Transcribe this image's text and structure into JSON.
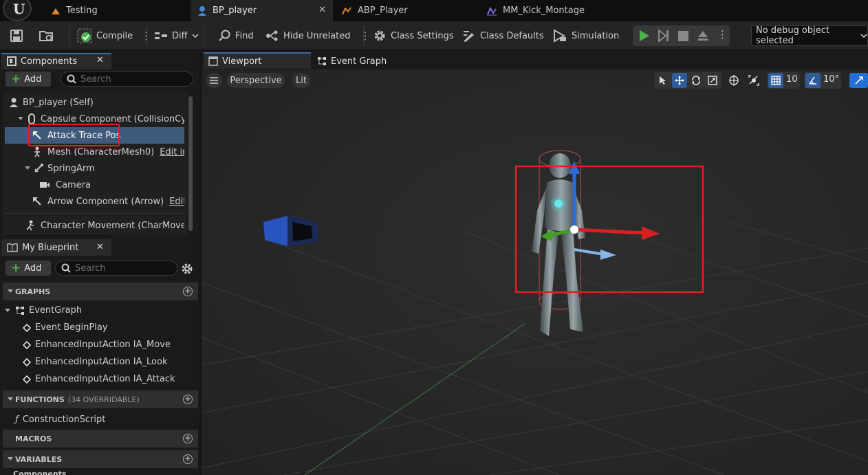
{
  "tabs": [
    {
      "label": "Testing",
      "icon": "level-icon"
    },
    {
      "label": "BP_player",
      "icon": "blueprint-pawn-icon",
      "active": true
    },
    {
      "label": "ABP_Player",
      "icon": "anim-blueprint-icon"
    },
    {
      "label": "MM_Kick_Montage",
      "icon": "montage-icon"
    }
  ],
  "toolbar": {
    "compile": "Compile",
    "diff": "Diff",
    "find": "Find",
    "hide_unrelated": "Hide Unrelated",
    "class_settings": "Class Settings",
    "class_defaults": "Class Defaults",
    "simulation": "Simulation",
    "debug_object": "No debug object selected"
  },
  "components_panel": {
    "title": "Components",
    "add_label": "Add",
    "search_placeholder": "Search",
    "items": [
      {
        "label": "BP_player (Self)",
        "indent": 0
      },
      {
        "label": "Capsule Component (CollisionCylinder)",
        "indent": 1
      },
      {
        "label": "Attack Trace Pos",
        "indent": 2,
        "selected": true
      },
      {
        "label": "Mesh (CharacterMesh0)",
        "indent": 2,
        "link": "Edit in C++"
      },
      {
        "label": "SpringArm",
        "indent": 2
      },
      {
        "label": "Camera",
        "indent": 3
      },
      {
        "label": "Arrow Component (Arrow)",
        "indent": 2,
        "link": "Edit in C++"
      },
      {
        "label": "Character Movement (CharMoveComp)",
        "indent": 1
      }
    ]
  },
  "my_blueprint": {
    "title": "My Blueprint",
    "add_label": "Add",
    "search_placeholder": "Search",
    "graphs_label": "GRAPHS",
    "event_graph": "EventGraph",
    "events": [
      "Event BeginPlay",
      "EnhancedInputAction IA_Move",
      "EnhancedInputAction IA_Look",
      "EnhancedInputAction IA_Attack"
    ],
    "functions_label": "FUNCTIONS",
    "functions_sub": "(34 OVERRIDABLE)",
    "construction_script": "ConstructionScript",
    "macros_label": "MACROS",
    "variables_label": "VARIABLES",
    "components_label": "Components"
  },
  "viewport": {
    "tab_viewport": "Viewport",
    "tab_event_graph": "Event Graph",
    "perspective": "Perspective",
    "lit": "Lit",
    "grid_snap": "10",
    "rotation_snap": "10°"
  },
  "colors": {
    "accent_blue": "#3f5a7a",
    "highlight_red": "#e02020",
    "play_green": "#4cb24c"
  }
}
